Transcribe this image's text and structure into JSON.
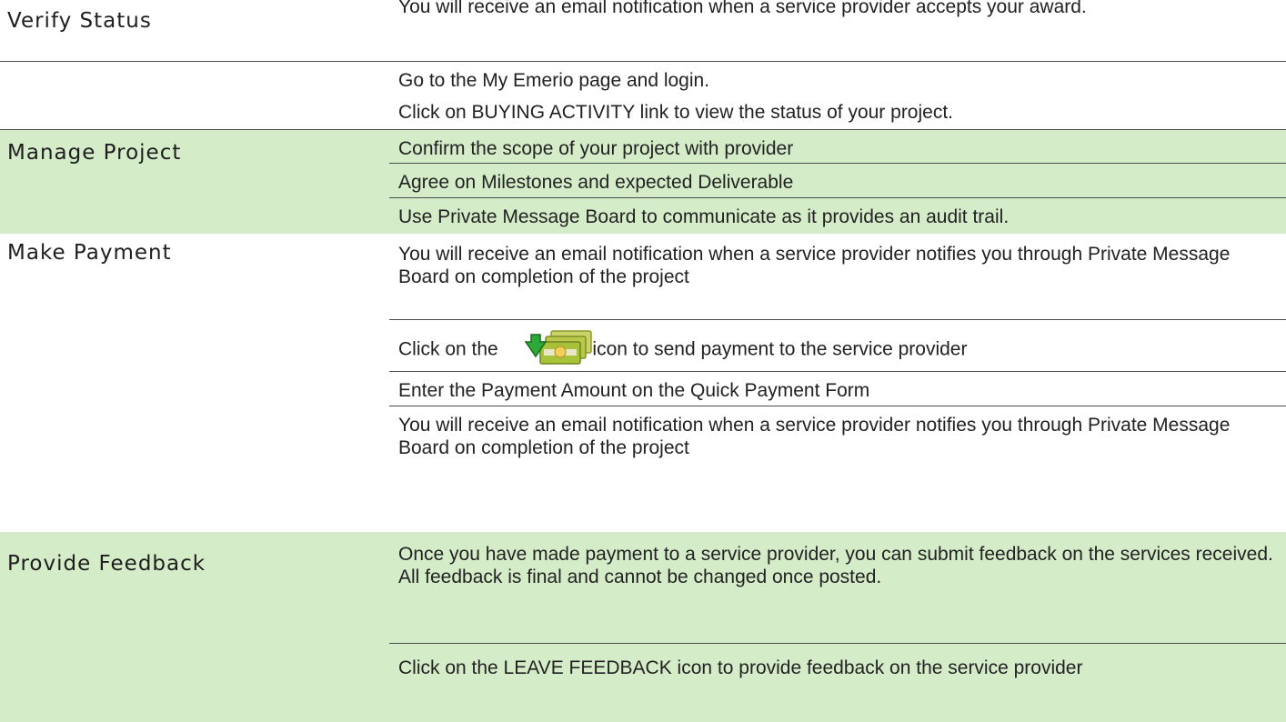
{
  "sections": [
    {
      "label": "Verify Status",
      "steps": [
        "You will receive an email notification when a service provider accepts your award.",
        "Go to the My Emerio page and login.",
        "Click on BUYING ACTIVITY link to view the status of your project."
      ]
    },
    {
      "label": "Manage Project",
      "steps": [
        "Confirm the scope of your project with provider",
        "Agree on Milestones and expected Deliverable",
        "Use Private Message Board to communicate as it provides an audit trail."
      ]
    },
    {
      "label": "Make Payment",
      "steps": [
        "You will receive an email notification when a service provider notifies you through Private Message Board on completion of the project",
        {
          "before": "Click on the",
          "icon": "payment-icon",
          "after": "icon to send payment to the service provider"
        },
        "Enter the Payment Amount on the Quick Payment Form",
        "You will receive an email notification when a service provider notifies you through Private Message Board on completion of the project"
      ]
    },
    {
      "label": "Provide Feedback",
      "steps": [
        "Once you have made payment to a service provider, you can submit feedback on the services received. All feedback is final and cannot be changed once posted.",
        "Click on the LEAVE FEEDBACK icon to provide feedback on the service provider"
      ]
    }
  ],
  "colors": {
    "green_row": "#d5ecc9",
    "white_row": "#ffffff",
    "rule": "#4a4a4a"
  }
}
